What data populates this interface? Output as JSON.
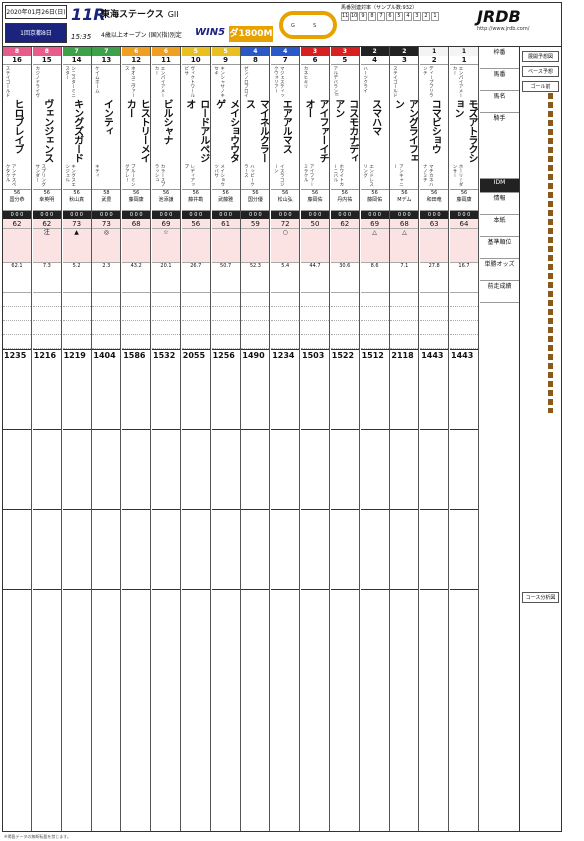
{
  "header": {
    "date": "2020年01月26日(日)",
    "meeting": "1回京都8日",
    "race_number": "11R",
    "race_name": "東海ステークス",
    "grade": "GII",
    "start_time": "15:35",
    "conditions": "4歳以上オープン (国)(指)別定",
    "win5": "WIN5",
    "distance": "ダ1800M",
    "stats_title": "馬番別連対率（サンプル数:932）",
    "stats_nums": [
      "11",
      "10",
      "9",
      "8",
      "7",
      "6",
      "5",
      "4",
      "3",
      "2",
      "1"
    ],
    "logo": "JRDB",
    "logo_url": "http://www.jrdb.com/"
  },
  "horses": [
    {
      "gate": "8",
      "gate_color": "#e85c8c",
      "num": "16",
      "name": "ヒロブレイブ",
      "sire": "ステイゴールド",
      "dam": "アンナスペクタクル",
      "jockey": "国分恭",
      "weight": "56",
      "index": "62",
      "marks": "",
      "odds": "62.1",
      "past_time": "1235"
    },
    {
      "gate": "8",
      "gate_color": "#e85c8c",
      "num": "15",
      "name": "ヴェンジェンス",
      "sire": "カジノドライヴ",
      "dam": "スプリングサンダー",
      "jockey": "幸英明",
      "weight": "56",
      "index": "62",
      "marks": "注",
      "odds": "7.3",
      "past_time": "1216"
    },
    {
      "gate": "7",
      "gate_color": "#3da14a",
      "num": "14",
      "name": "キングズガード",
      "sire": "シニスターミニスター",
      "dam": "キングスエンジェル",
      "jockey": "秋山真",
      "weight": "56",
      "index": "73",
      "marks": "▲",
      "odds": "5.2",
      "past_time": "1219"
    },
    {
      "gate": "7",
      "gate_color": "#3da14a",
      "num": "13",
      "name": "インティ",
      "sire": "ケイムホーム",
      "dam": "キティ",
      "jockey": "武豊",
      "weight": "58",
      "index": "73",
      "marks": "◎",
      "odds": "2.3",
      "past_time": "1404"
    },
    {
      "gate": "6",
      "gate_color": "#f0a020",
      "num": "12",
      "name": "ヒストリーメイカー",
      "sire": "ネオユニヴァース",
      "dam": "ブルーミングアレー",
      "jockey": "藤岡康",
      "weight": "56",
      "index": "68",
      "marks": "",
      "odds": "43.2",
      "past_time": "1586"
    },
    {
      "gate": "6",
      "gate_color": "#f0a020",
      "num": "11",
      "name": "ビルシャナ",
      "sire": "エンパイアメーカー",
      "dam": "カラースプラッシュ",
      "jockey": "池添謙",
      "weight": "56",
      "index": "69",
      "marks": "☆",
      "odds": "20.1",
      "past_time": "1532"
    },
    {
      "gate": "5",
      "gate_color": "#e8c020",
      "num": "10",
      "name": "ロードアルペジオ",
      "sire": "ヴィクトワールピサ",
      "dam": "レディアップ",
      "jockey": "藤井勘",
      "weight": "56",
      "index": "56",
      "marks": "",
      "odds": "26.7",
      "past_time": "2055"
    },
    {
      "gate": "5",
      "gate_color": "#e8c020",
      "num": "9",
      "name": "メイショウウタゲ",
      "sire": "キンシャサノキセキ",
      "dam": "メイショウツバサ",
      "jockey": "武藤雅",
      "weight": "56",
      "index": "61",
      "marks": "",
      "odds": "50.7",
      "past_time": "1256"
    },
    {
      "gate": "4",
      "gate_color": "#2a58c8",
      "num": "8",
      "name": "マイネルクラース",
      "sire": "ゼンノロブロイ",
      "dam": "ハッピークラース",
      "jockey": "国分優",
      "weight": "56",
      "index": "59",
      "marks": "",
      "odds": "52.3",
      "past_time": "1490"
    },
    {
      "gate": "4",
      "gate_color": "#2a58c8",
      "num": "7",
      "name": "エアアルマス",
      "sire": "マジェスティックウォリアー",
      "dam": "イスラコジーン",
      "jockey": "松山弘",
      "weight": "56",
      "index": "72",
      "marks": "○",
      "odds": "5.4",
      "past_time": "1234"
    },
    {
      "gate": "3",
      "gate_color": "#d82020",
      "num": "6",
      "name": "アイファーイチオー",
      "sire": "カネヒキリ",
      "dam": "アイファーミラクル",
      "jockey": "藤岡佑",
      "weight": "56",
      "index": "50",
      "marks": "",
      "odds": "44.7",
      "past_time": "1503"
    },
    {
      "gate": "3",
      "gate_color": "#d82020",
      "num": "5",
      "name": "コスモカナディアン",
      "sire": "アルデバランII",
      "dam": "ホワイトカーニバル",
      "jockey": "丹内祐",
      "weight": "56",
      "index": "62",
      "marks": "",
      "odds": "30.6",
      "past_time": "1522"
    },
    {
      "gate": "2",
      "gate_color": "#222222",
      "num": "4",
      "name": "スマハマ",
      "sire": "ハーツクライ",
      "dam": "エンドレスリング",
      "jockey": "藤岡佑",
      "weight": "56",
      "index": "69",
      "marks": "△",
      "odds": "8.6",
      "past_time": "1512"
    },
    {
      "gate": "2",
      "gate_color": "#222222",
      "num": "3",
      "name": "アングライフェン",
      "sire": "ステイゴールド",
      "dam": "アンキャニー",
      "jockey": "Mデム",
      "weight": "56",
      "index": "68",
      "marks": "△",
      "odds": "7.1",
      "past_time": "2118"
    },
    {
      "gate": "1",
      "gate_color": "#f4f4f4",
      "num": "2",
      "name": "コマビショウ",
      "sire": "ディープブリランテ",
      "dam": "マチカネハナノミチ",
      "jockey": "和田竜",
      "weight": "56",
      "index": "63",
      "marks": "",
      "odds": "27.8",
      "past_time": "1443"
    },
    {
      "gate": "1",
      "gate_color": "#f4f4f4",
      "num": "1",
      "name": "モズアトラクション",
      "sire": "エンパイアメーカー",
      "dam": "ホーリーダンサー",
      "jockey": "藤岡康",
      "weight": "56",
      "index": "64",
      "marks": "",
      "odds": "16.7",
      "past_time": "1443"
    }
  ],
  "side": {
    "row_labels": [
      "枠番",
      "馬番",
      "馬名",
      "騎手",
      "IDM",
      "情報",
      "本紙",
      "基準順位",
      "単勝オッズ",
      "前走成績"
    ],
    "right_title": "展開予想図",
    "right_sub": "ベース予想",
    "goal": "ゴール前",
    "bottom_note": "コース分析図"
  },
  "footer": "※掲載データの無断転載を禁じます。"
}
